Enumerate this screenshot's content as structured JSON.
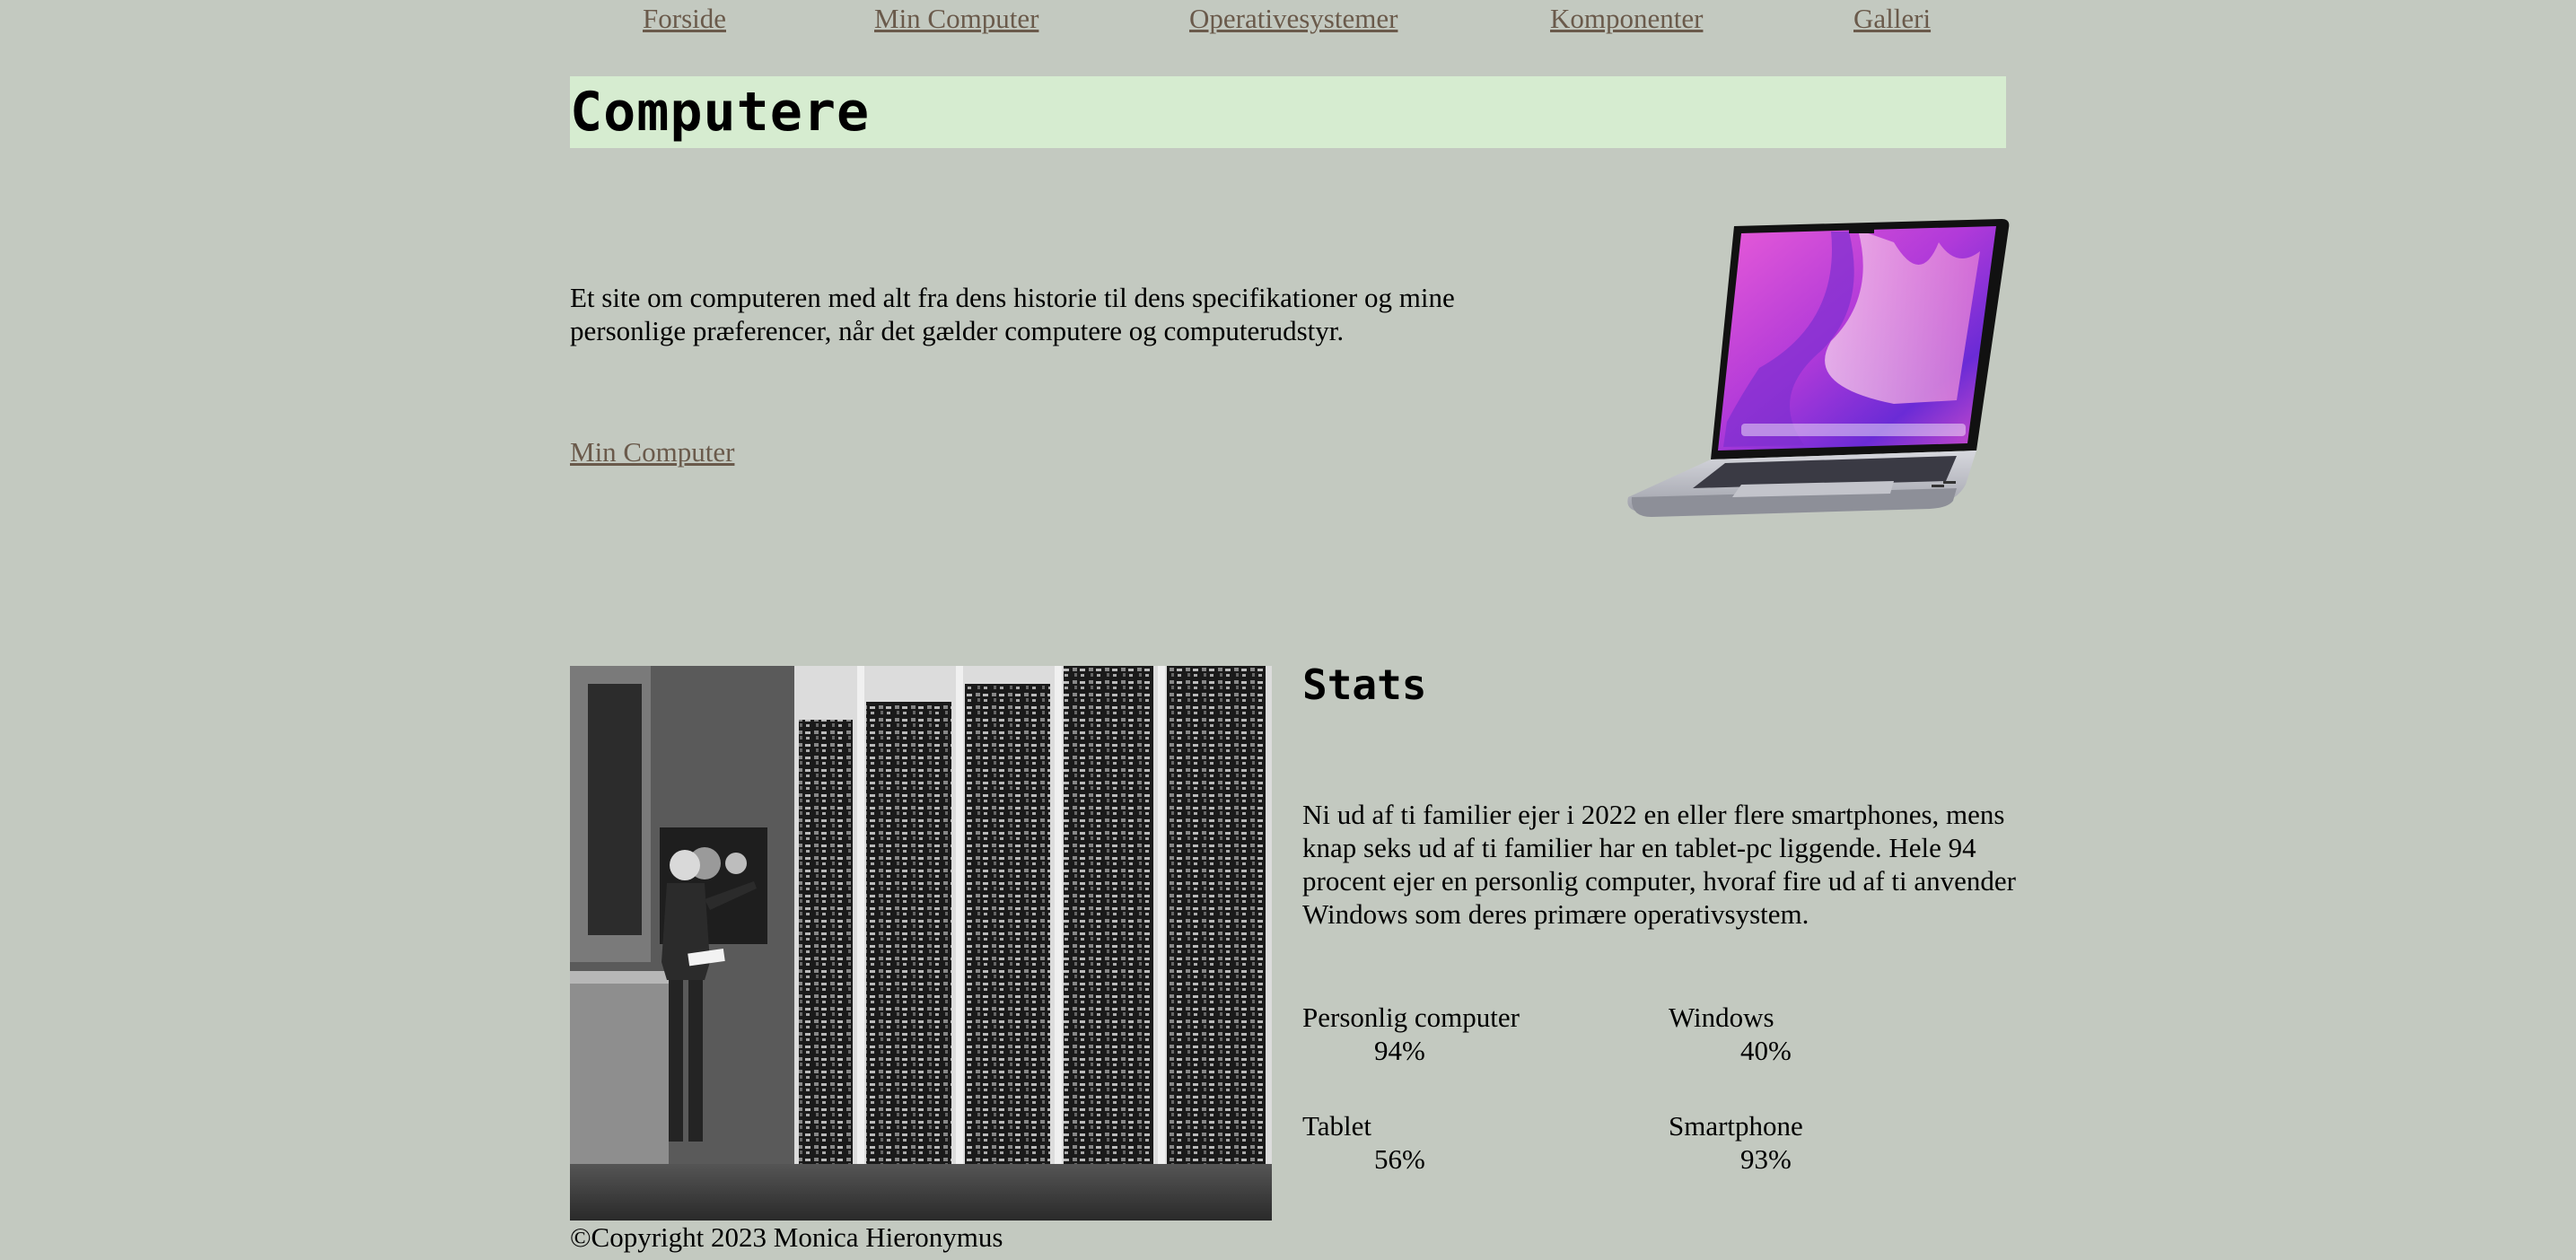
{
  "nav": {
    "items": [
      {
        "label": "Forside"
      },
      {
        "label": "Min Computer"
      },
      {
        "label": "Operativesystemer"
      },
      {
        "label": "Komponenter"
      },
      {
        "label": "Galleri"
      }
    ]
  },
  "banner": {
    "title": "Computere",
    "background": "#d6ecd0"
  },
  "intro": {
    "text": "Et site om computeren med alt fra dens historie til dens specifikationer og mine personlige præferencer, når det gælder computere og computerudstyr.",
    "link_label": "Min Computer",
    "image_icon": "laptop-image"
  },
  "photo": {
    "icon": "server-room-photo"
  },
  "stats": {
    "title": "Stats",
    "text": "Ni ud af ti familier ejer i 2022 en eller flere smartphones, mens knap seks ud af ti familier har en tablet-pc liggende. Hele 94 procent ejer en personlig computer, hvoraf fire ud af ti anvender Windows som deres primære operativsystem.",
    "items": [
      {
        "label": "Personlig computer",
        "value": "94%"
      },
      {
        "label": "Windows",
        "value": "40%"
      },
      {
        "label": "Tablet",
        "value": "56%"
      },
      {
        "label": "Smartphone",
        "value": "93%"
      }
    ]
  },
  "footer": {
    "copyright": "©Copyright 2023 Monica Hieronymus"
  },
  "colors": {
    "page_background": "#c3c9c0",
    "link": "#6a5a4b",
    "banner": "#d6ecd0"
  }
}
